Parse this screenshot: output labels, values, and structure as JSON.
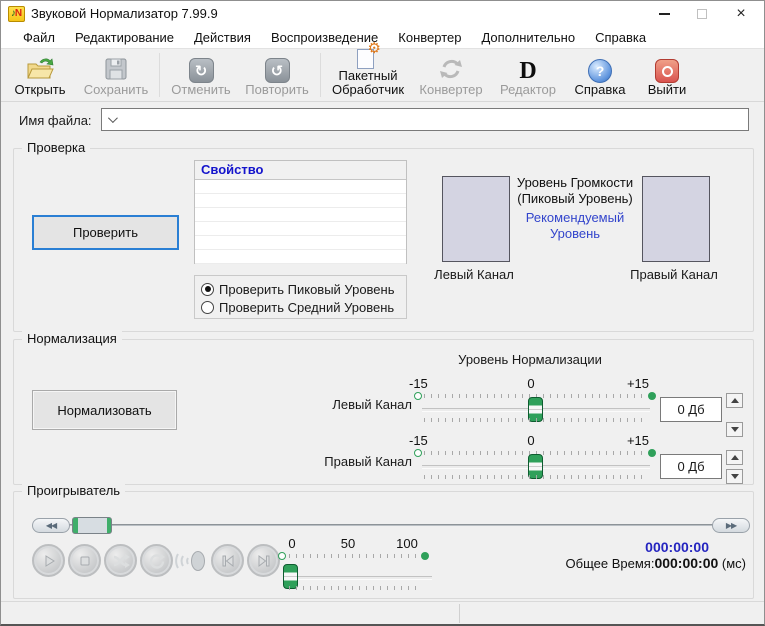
{
  "window": {
    "title": "Звуковой Нормализатор 7.99.9"
  },
  "icons": {
    "close": "×",
    "undo_glyph": "↻",
    "redo_glyph": "↺",
    "gear_glyph": "⚙",
    "editor_glyph": "D",
    "help_glyph": "?",
    "app_note": "♪",
    "app_letter": "N",
    "seek_back": "◀◀",
    "seek_fwd": "▶▶"
  },
  "menu": {
    "items": [
      "Файл",
      "Редактирование",
      "Действия",
      "Воспроизведение",
      "Конвертер",
      "Дополнительно",
      "Справка"
    ]
  },
  "toolbar": {
    "items": [
      {
        "label": "Открыть",
        "enabled": true
      },
      {
        "label": "Сохранить",
        "enabled": false
      },
      {
        "label": "Отменить",
        "enabled": false
      },
      {
        "label": "Повторить",
        "enabled": false
      },
      {
        "label": "Пакетный Обработчик",
        "enabled": true
      },
      {
        "label": "Конвертер",
        "enabled": false
      },
      {
        "label": "Редактор",
        "enabled": false
      },
      {
        "label": "Справка",
        "enabled": true
      },
      {
        "label": "Выйти",
        "enabled": true
      }
    ]
  },
  "file": {
    "label": "Имя файла:",
    "value": ""
  },
  "check": {
    "label": "Проверка",
    "button": "Проверить",
    "table_header": "Свойство",
    "radio_peak": "Проверить Пиковый Уровень",
    "radio_mean": "Проверить Средний Уровень",
    "level_title_line1": "Уровень Громкости",
    "level_title_line2": "(Пиковый Уровень)",
    "recommended_line1": "Рекомендуемый",
    "recommended_line2": "Уровень",
    "left_channel": "Левый Канал",
    "right_channel": "Правый Канал"
  },
  "normalize": {
    "label": "Нормализация",
    "button": "Нормализовать",
    "title": "Уровень Нормализации",
    "left_channel": "Левый Канал",
    "right_channel": "Правый Канал",
    "scale_min": "-15",
    "scale_zero": "0",
    "scale_max": "+15",
    "left_value": "0 Дб",
    "right_value": "0 Дб"
  },
  "player": {
    "label": "Проигрыватель",
    "vol_min": "0",
    "vol_mid": "50",
    "vol_max": "100",
    "current_time": "000:00:00",
    "total_label": "Общее Время:",
    "total_value": "000:00:00",
    "total_unit": "(мс)"
  },
  "colors": {
    "accent_green": "#2fa05a",
    "table_header_blue": "#1414cc",
    "recommended_blue": "#3345cc",
    "time_blue": "#2525c0",
    "focus_border_blue": "#2a7fd4",
    "exit_red": "#d9534f"
  }
}
